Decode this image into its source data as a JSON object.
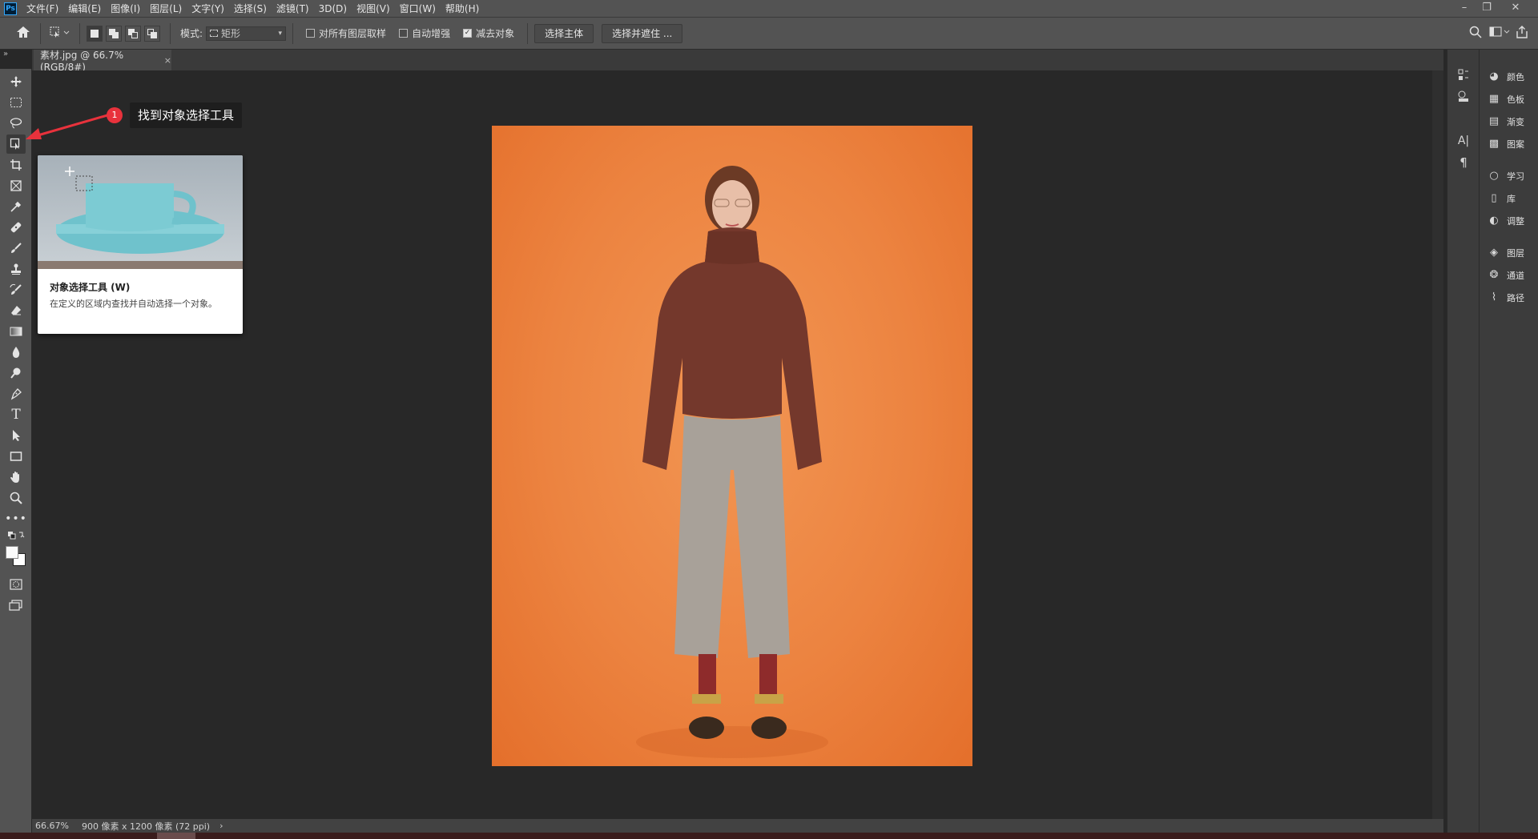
{
  "app": {
    "logo": "Ps"
  },
  "menu": [
    "文件(F)",
    "编辑(E)",
    "图像(I)",
    "图层(L)",
    "文字(Y)",
    "选择(S)",
    "滤镜(T)",
    "3D(D)",
    "视图(V)",
    "窗口(W)",
    "帮助(H)"
  ],
  "options_bar": {
    "mode_label": "模式:",
    "mode_value": "矩形",
    "checkbox_all_layers": {
      "label": "对所有图层取样",
      "checked": false
    },
    "checkbox_auto_enhance": {
      "label": "自动增强",
      "checked": false
    },
    "checkbox_subtract": {
      "label": "减去对象",
      "checked": true
    },
    "select_subject_button": "选择主体",
    "select_and_mask_button": "选择并遮住 ..."
  },
  "document_tab": {
    "title": "素材.jpg @ 66.7%(RGB/8#)",
    "close": "×"
  },
  "status_bar": {
    "zoom": "66.67%",
    "doc_info": "900 像素 x 1200 像素 (72 ppi)",
    "arrow": "›"
  },
  "annotation": {
    "number": "1",
    "text": "找到对象选择工具"
  },
  "tooltip": {
    "title": "对象选择工具 (W)",
    "description": "在定义的区域内查找并自动选择一个对象。"
  },
  "panels": [
    "颜色",
    "色板",
    "渐变",
    "图案",
    "学习",
    "库",
    "调整",
    "图层",
    "通道",
    "路径"
  ],
  "colors": {
    "accent": "#e8323c",
    "canvas_bg": "#ec8340",
    "chrome": "#535353"
  }
}
